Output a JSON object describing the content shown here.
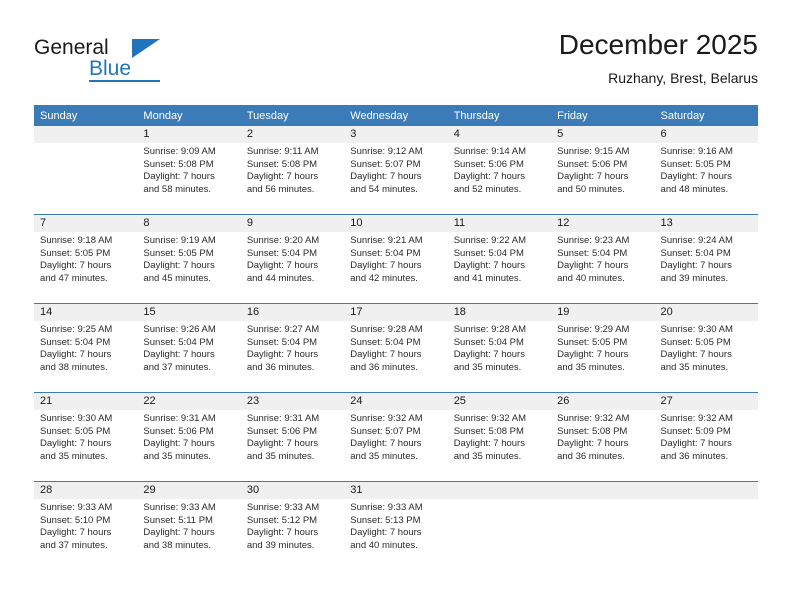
{
  "brand": {
    "name_top": "General",
    "name_bottom": "Blue",
    "accent_color": "#1f74bd",
    "logo_icon": "triangle-flag-icon"
  },
  "header": {
    "title": "December 2025",
    "subtitle": "Ruzhany, Brest, Belarus"
  },
  "calendar": {
    "header_bg": "#3b7cb8",
    "daynum_bg": "#f0f0f0",
    "weekday_headers": [
      "Sunday",
      "Monday",
      "Tuesday",
      "Wednesday",
      "Thursday",
      "Friday",
      "Saturday"
    ],
    "weeks": [
      [
        {
          "day": "",
          "lines": []
        },
        {
          "day": "1",
          "lines": [
            "Sunrise: 9:09 AM",
            "Sunset: 5:08 PM",
            "Daylight: 7 hours",
            "and 58 minutes."
          ]
        },
        {
          "day": "2",
          "lines": [
            "Sunrise: 9:11 AM",
            "Sunset: 5:08 PM",
            "Daylight: 7 hours",
            "and 56 minutes."
          ]
        },
        {
          "day": "3",
          "lines": [
            "Sunrise: 9:12 AM",
            "Sunset: 5:07 PM",
            "Daylight: 7 hours",
            "and 54 minutes."
          ]
        },
        {
          "day": "4",
          "lines": [
            "Sunrise: 9:14 AM",
            "Sunset: 5:06 PM",
            "Daylight: 7 hours",
            "and 52 minutes."
          ]
        },
        {
          "day": "5",
          "lines": [
            "Sunrise: 9:15 AM",
            "Sunset: 5:06 PM",
            "Daylight: 7 hours",
            "and 50 minutes."
          ]
        },
        {
          "day": "6",
          "lines": [
            "Sunrise: 9:16 AM",
            "Sunset: 5:05 PM",
            "Daylight: 7 hours",
            "and 48 minutes."
          ]
        }
      ],
      [
        {
          "day": "7",
          "lines": [
            "Sunrise: 9:18 AM",
            "Sunset: 5:05 PM",
            "Daylight: 7 hours",
            "and 47 minutes."
          ]
        },
        {
          "day": "8",
          "lines": [
            "Sunrise: 9:19 AM",
            "Sunset: 5:05 PM",
            "Daylight: 7 hours",
            "and 45 minutes."
          ]
        },
        {
          "day": "9",
          "lines": [
            "Sunrise: 9:20 AM",
            "Sunset: 5:04 PM",
            "Daylight: 7 hours",
            "and 44 minutes."
          ]
        },
        {
          "day": "10",
          "lines": [
            "Sunrise: 9:21 AM",
            "Sunset: 5:04 PM",
            "Daylight: 7 hours",
            "and 42 minutes."
          ]
        },
        {
          "day": "11",
          "lines": [
            "Sunrise: 9:22 AM",
            "Sunset: 5:04 PM",
            "Daylight: 7 hours",
            "and 41 minutes."
          ]
        },
        {
          "day": "12",
          "lines": [
            "Sunrise: 9:23 AM",
            "Sunset: 5:04 PM",
            "Daylight: 7 hours",
            "and 40 minutes."
          ]
        },
        {
          "day": "13",
          "lines": [
            "Sunrise: 9:24 AM",
            "Sunset: 5:04 PM",
            "Daylight: 7 hours",
            "and 39 minutes."
          ]
        }
      ],
      [
        {
          "day": "14",
          "lines": [
            "Sunrise: 9:25 AM",
            "Sunset: 5:04 PM",
            "Daylight: 7 hours",
            "and 38 minutes."
          ]
        },
        {
          "day": "15",
          "lines": [
            "Sunrise: 9:26 AM",
            "Sunset: 5:04 PM",
            "Daylight: 7 hours",
            "and 37 minutes."
          ]
        },
        {
          "day": "16",
          "lines": [
            "Sunrise: 9:27 AM",
            "Sunset: 5:04 PM",
            "Daylight: 7 hours",
            "and 36 minutes."
          ]
        },
        {
          "day": "17",
          "lines": [
            "Sunrise: 9:28 AM",
            "Sunset: 5:04 PM",
            "Daylight: 7 hours",
            "and 36 minutes."
          ]
        },
        {
          "day": "18",
          "lines": [
            "Sunrise: 9:28 AM",
            "Sunset: 5:04 PM",
            "Daylight: 7 hours",
            "and 35 minutes."
          ]
        },
        {
          "day": "19",
          "lines": [
            "Sunrise: 9:29 AM",
            "Sunset: 5:05 PM",
            "Daylight: 7 hours",
            "and 35 minutes."
          ]
        },
        {
          "day": "20",
          "lines": [
            "Sunrise: 9:30 AM",
            "Sunset: 5:05 PM",
            "Daylight: 7 hours",
            "and 35 minutes."
          ]
        }
      ],
      [
        {
          "day": "21",
          "lines": [
            "Sunrise: 9:30 AM",
            "Sunset: 5:05 PM",
            "Daylight: 7 hours",
            "and 35 minutes."
          ]
        },
        {
          "day": "22",
          "lines": [
            "Sunrise: 9:31 AM",
            "Sunset: 5:06 PM",
            "Daylight: 7 hours",
            "and 35 minutes."
          ]
        },
        {
          "day": "23",
          "lines": [
            "Sunrise: 9:31 AM",
            "Sunset: 5:06 PM",
            "Daylight: 7 hours",
            "and 35 minutes."
          ]
        },
        {
          "day": "24",
          "lines": [
            "Sunrise: 9:32 AM",
            "Sunset: 5:07 PM",
            "Daylight: 7 hours",
            "and 35 minutes."
          ]
        },
        {
          "day": "25",
          "lines": [
            "Sunrise: 9:32 AM",
            "Sunset: 5:08 PM",
            "Daylight: 7 hours",
            "and 35 minutes."
          ]
        },
        {
          "day": "26",
          "lines": [
            "Sunrise: 9:32 AM",
            "Sunset: 5:08 PM",
            "Daylight: 7 hours",
            "and 36 minutes."
          ]
        },
        {
          "day": "27",
          "lines": [
            "Sunrise: 9:32 AM",
            "Sunset: 5:09 PM",
            "Daylight: 7 hours",
            "and 36 minutes."
          ]
        }
      ],
      [
        {
          "day": "28",
          "lines": [
            "Sunrise: 9:33 AM",
            "Sunset: 5:10 PM",
            "Daylight: 7 hours",
            "and 37 minutes."
          ]
        },
        {
          "day": "29",
          "lines": [
            "Sunrise: 9:33 AM",
            "Sunset: 5:11 PM",
            "Daylight: 7 hours",
            "and 38 minutes."
          ]
        },
        {
          "day": "30",
          "lines": [
            "Sunrise: 9:33 AM",
            "Sunset: 5:12 PM",
            "Daylight: 7 hours",
            "and 39 minutes."
          ]
        },
        {
          "day": "31",
          "lines": [
            "Sunrise: 9:33 AM",
            "Sunset: 5:13 PM",
            "Daylight: 7 hours",
            "and 40 minutes."
          ]
        },
        {
          "day": "",
          "lines": []
        },
        {
          "day": "",
          "lines": []
        },
        {
          "day": "",
          "lines": []
        }
      ]
    ]
  }
}
